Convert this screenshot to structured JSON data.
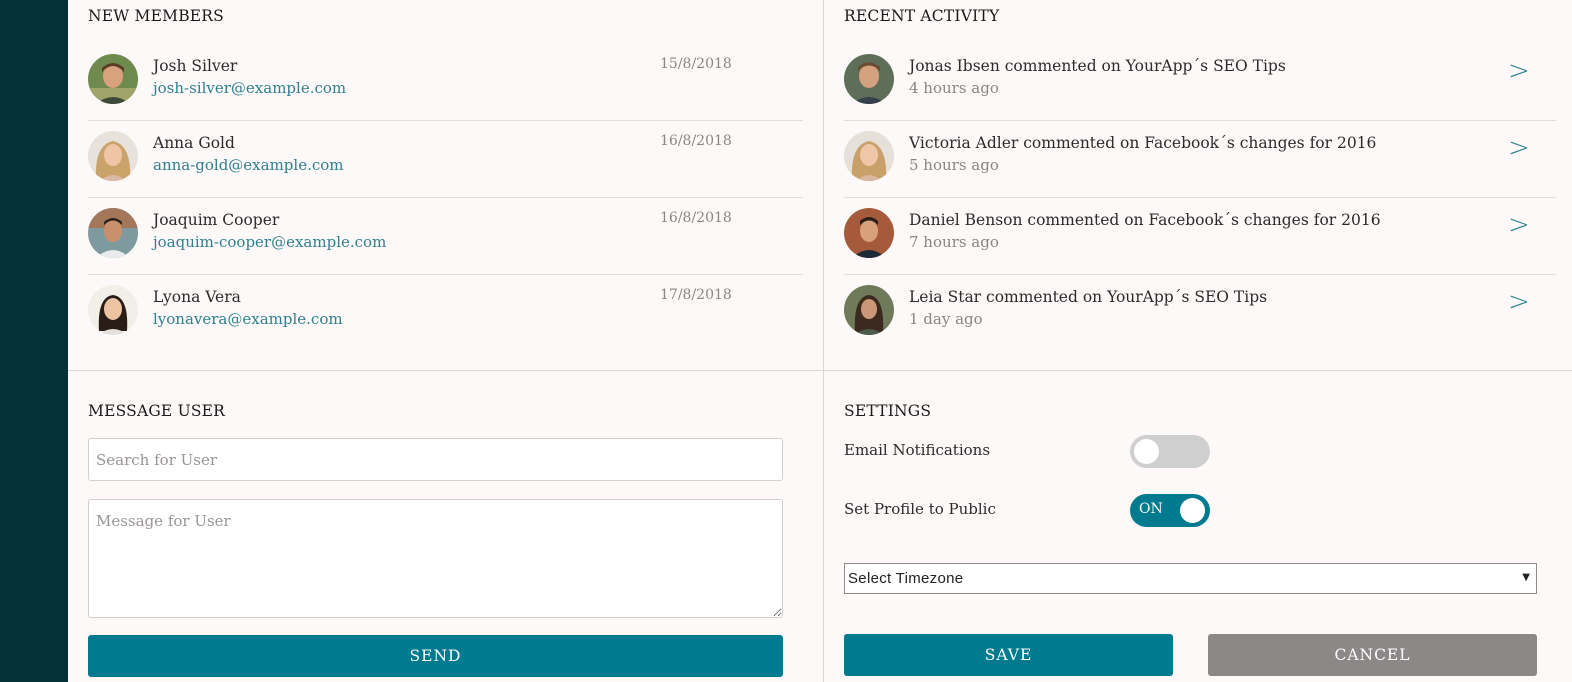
{
  "new_members": {
    "title": "NEW MEMBERS",
    "items": [
      {
        "name": "Josh Silver",
        "email": "josh-silver@example.com",
        "date": "15/8/2018"
      },
      {
        "name": "Anna Gold",
        "email": "anna-gold@example.com",
        "date": "16/8/2018"
      },
      {
        "name": "Joaquim Cooper",
        "email": "joaquim-cooper@example.com",
        "date": "16/8/2018"
      },
      {
        "name": "Lyona Vera",
        "email": "lyonavera@example.com",
        "date": "17/8/2018"
      }
    ]
  },
  "recent_activity": {
    "title": "RECENT ACTIVITY",
    "arrow": ">",
    "items": [
      {
        "text": "Jonas Ibsen commented on YourApp´s SEO Tips",
        "time": "4 hours ago"
      },
      {
        "text": "Victoria Adler commented on Facebook´s changes for 2016",
        "time": "5 hours ago"
      },
      {
        "text": "Daniel Benson commented on Facebook´s changes for 2016",
        "time": "7 hours ago"
      },
      {
        "text": "Leia Star commented on YourApp´s SEO Tips",
        "time": "1 day ago"
      }
    ]
  },
  "message_user": {
    "title": "MESSAGE USER",
    "search_placeholder": "Search for User",
    "message_placeholder": "Message for User",
    "send_label": "SEND"
  },
  "settings": {
    "title": "SETTINGS",
    "email_notifications_label": "Email Notifications",
    "email_notifications_on": false,
    "public_profile_label": "Set Profile to Public",
    "public_profile_on": true,
    "public_profile_toggle_text": "ON",
    "timezone_value": "Select Timezone",
    "select_arrow": "▼",
    "save_label": "SAVE",
    "cancel_label": "CANCEL"
  },
  "colors": {
    "sidebar": "#04313a",
    "primary": "#007a8f",
    "link": "#2f7f8f",
    "gray_button": "#8c8888",
    "toggle_off": "#cfcfcf"
  }
}
